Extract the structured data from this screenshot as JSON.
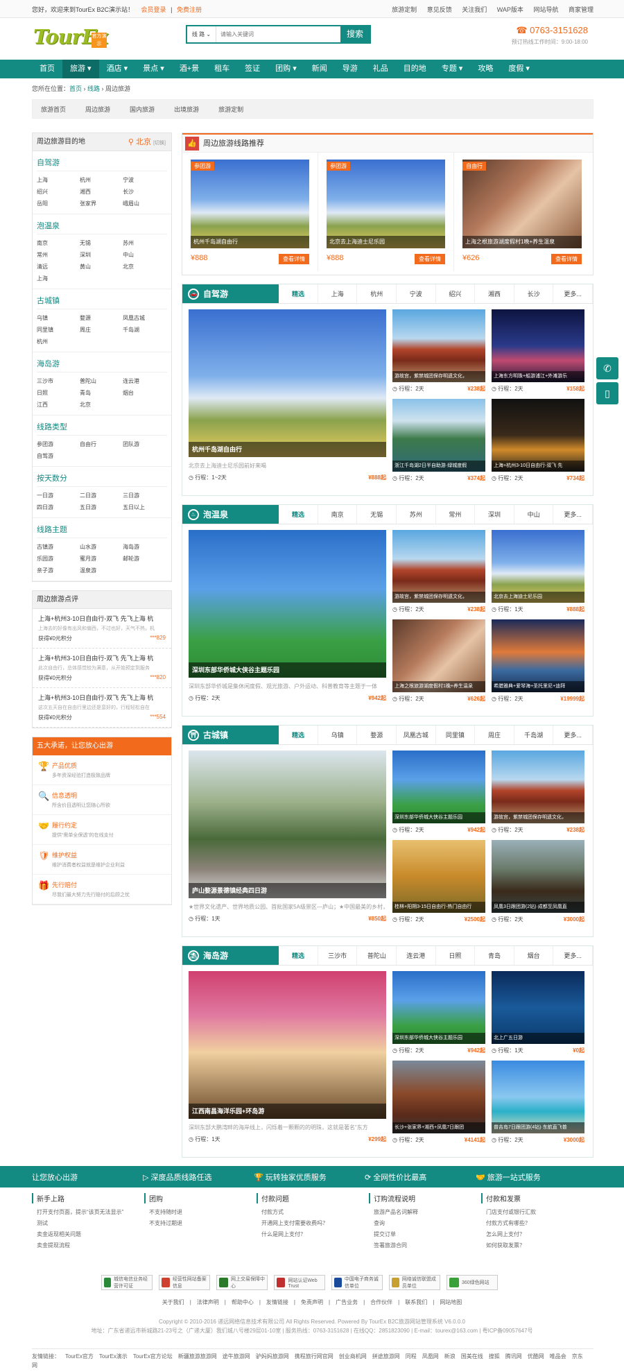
{
  "topbar": {
    "welcome": "您好，欢迎来到TourEx B2C演示站！",
    "login": "会员登录",
    "register": "免费注册",
    "links": [
      "旅游定制",
      "意见反馈",
      "关注我们",
      "WAP版本",
      "网站导航",
      "商家管理"
    ]
  },
  "logo": {
    "text": "TourEx",
    "badge": "官方演示"
  },
  "search": {
    "scope": "线 路",
    "placeholder": "请输入关键词",
    "button": "搜索"
  },
  "hotline": {
    "number": "0763-3151628",
    "hours": "预订热线工作时间：9:00-18:00"
  },
  "nav": [
    "首页",
    "旅游",
    "酒店",
    "景点",
    "酒+景",
    "租车",
    "签证",
    "团购",
    "新闻",
    "导游",
    "礼品",
    "目的地",
    "专题",
    "攻略",
    "度假"
  ],
  "crumb": {
    "prefix": "您所在位置：",
    "home": "首页",
    "line": "线路",
    "current": "周边旅游"
  },
  "subtabs": [
    "旅游首页",
    "周边旅游",
    "国内旅游",
    "出境旅游",
    "旅游定制"
  ],
  "sidebar": {
    "dest_title": "周边旅游目的地",
    "city": "北京",
    "switch": "[切换]",
    "groups": [
      {
        "title": "自驾游",
        "items": [
          "上海",
          "杭州",
          "宁波",
          "绍兴",
          "湘西",
          "长沙",
          "岳阳",
          "张家界",
          "峨眉山"
        ]
      },
      {
        "title": "泡温泉",
        "items": [
          "南京",
          "无锡",
          "苏州",
          "常州",
          "深圳",
          "中山",
          "清远",
          "黄山",
          "北京",
          "上海"
        ]
      },
      {
        "title": "古城镇",
        "items": [
          "乌镇",
          "婺源",
          "凤凰古城",
          "同里镇",
          "周庄",
          "千岛湖",
          "杭州"
        ]
      },
      {
        "title": "海岛游",
        "items": [
          "三沙市",
          "普陀山",
          "连云港",
          "日照",
          "青岛",
          "烟台",
          "江西",
          "北京"
        ]
      },
      {
        "title": "线路类型",
        "items": [
          "参团游",
          "自由行",
          "团队游",
          "自驾游"
        ]
      },
      {
        "title": "按天数分",
        "items": [
          "一日游",
          "二日游",
          "三日游",
          "四日游",
          "五日游",
          "五日以上"
        ]
      },
      {
        "title": "线路主题",
        "items": [
          "古镇游",
          "山水游",
          "海岛游",
          "乐园游",
          "蜜月游",
          "邮轮游",
          "亲子游",
          "温泉游"
        ]
      }
    ],
    "review_title": "周边旅游点评",
    "reviews": [
      {
        "title": "上海+杭州3-10日自由行-双飞 先飞上海 杭",
        "content": "上海去的好像有出风和偏西，不过也好，天气不热，机",
        "points": "获得¥0元积分",
        "user": "***829"
      },
      {
        "title": "上海+杭州3-10日自由行-双飞 先飞上海 杭",
        "content": "此次自由行，总体感觉较为满意，从开始预定到服务",
        "points": "获得¥0元积分",
        "user": "***820"
      },
      {
        "title": "上海+杭州3-10日自由行-双飞 先飞上海 杭",
        "content": "这次五天自在自由行里边还是蛮好的，行程轻松自在",
        "points": "获得¥0元积分",
        "user": "***554"
      }
    ],
    "promise_title": "五大承诺，让您放心出游",
    "promises": [
      {
        "t": "产品优质",
        "d": "多年资深经验打造极致品牌"
      },
      {
        "t": "信息透明",
        "d": "所含价目透明让您随心所欲"
      },
      {
        "t": "履行约定",
        "d": "提供“需单全保透”的在线支付"
      },
      {
        "t": "维护权益",
        "d": "维护消费者权益就是维护企业利益"
      },
      {
        "t": "先行赔付",
        "d": "尽我们最大努力先行赔付的后顾之忧"
      }
    ]
  },
  "recommend": {
    "title": "周边旅游线路推荐",
    "detail": "查看详情",
    "items": [
      {
        "tag": "参团游",
        "name": "杭州千岛湖自由行",
        "price": "¥888"
      },
      {
        "tag": "参团游",
        "name": "北京去上海迪士尼乐园",
        "price": "¥888"
      },
      {
        "tag": "自由行",
        "name": "上海之根旅游湖度假村1晚+养生温泉",
        "price": "¥626"
      }
    ]
  },
  "sections": [
    {
      "title": "自驾游",
      "tabs": [
        "精选",
        "上海",
        "杭州",
        "宁波",
        "绍兴",
        "湘西",
        "长沙",
        "更多..."
      ],
      "big": {
        "name": "杭州千岛湖自由行",
        "desc": "北京去上海迪士尼乐园前好来喝",
        "days": "行程：1~2天",
        "price": "¥888起"
      },
      "small": [
        {
          "name": "游故宫，紫禁城团保存明遗文化，",
          "days": "行程：2天",
          "price": "¥238起"
        },
        {
          "name": "上海东方明珠+船游浦江+外滩游乐",
          "days": "行程：2天",
          "price": "¥158起"
        },
        {
          "name": "浙江千岛湖2日半自助游·绿城度假",
          "days": "行程：2天",
          "price": "¥374起"
        },
        {
          "name": "上海+杭州3-10日自由行-双飞 先",
          "days": "行程：2天",
          "price": "¥734起"
        }
      ]
    },
    {
      "title": "泡温泉",
      "tabs": [
        "精选",
        "南京",
        "无锡",
        "苏州",
        "常州",
        "深圳",
        "中山",
        "更多..."
      ],
      "big": {
        "name": "深圳东部华侨城大侠谷主题乐园",
        "desc": "深圳东部华侨城是集休闲度假、观光旅游、户外运动、科普教育等主题于一体",
        "days": "行程：2天",
        "price": "¥942起"
      },
      "small": [
        {
          "name": "游故宫，紫禁城团保存明遗文化，",
          "days": "行程：2天",
          "price": "¥238起"
        },
        {
          "name": "北京去上海迪士尼乐园",
          "days": "行程：1天",
          "price": "¥888起"
        },
        {
          "name": "上海之根旅游湖度假村1晚+养生温泉",
          "days": "行程：2天",
          "price": "¥626起"
        },
        {
          "name": "希腊雅典+爱琴海+圣托里尼+迪拜",
          "days": "行程：2天",
          "price": "¥19999起"
        }
      ]
    },
    {
      "title": "古城镇",
      "tabs": [
        "精选",
        "乌镇",
        "婺源",
        "凤凰古城",
        "同里镇",
        "周庄",
        "千岛湖",
        "更多..."
      ],
      "big": {
        "name": "庐山婺源景德镇经典四日游",
        "desc": "★世界文化遗产、世界地质公园、首批国家5A级景区—庐山；★中国最美的乡村，朱",
        "days": "行程：1天",
        "price": "¥850起"
      },
      "small": [
        {
          "name": "深圳东部华侨城大侠谷主题乐园",
          "days": "行程：2天",
          "price": "¥942起"
        },
        {
          "name": "游故宫，紫禁城团保存明遗文化，",
          "days": "行程：2天",
          "price": "¥238起"
        },
        {
          "name": "桂林+阳朔3-15日自由行-热门自由行",
          "days": "行程：2天",
          "price": "¥2500起"
        },
        {
          "name": "凤凰3日跟团游(2钻)·成都至凤凰直",
          "days": "行程：2天",
          "price": "¥3000起"
        }
      ]
    },
    {
      "title": "海岛游",
      "tabs": [
        "精选",
        "三沙市",
        "普陀山",
        "连云港",
        "日照",
        "青岛",
        "烟台",
        "更多..."
      ],
      "big": {
        "name": "江西南昌海洋乐园+环岛游",
        "desc": "深圳东部大鹏湾畔的海岸线上，闪烁着一颗颗的的明珠，这就是著名“东方",
        "days": "行程：1天",
        "price": "¥299起"
      },
      "small": [
        {
          "name": "深圳东部华侨城大侠谷主题乐园",
          "days": "行程：2天",
          "price": "¥942起"
        },
        {
          "name": "北上广五日游",
          "days": "行程：1天",
          "price": "¥0起"
        },
        {
          "name": "长沙+张家界+湘西+凤凰7日跟团",
          "days": "行程：2天",
          "price": "¥4141起"
        },
        {
          "name": "普吉岛7日跟团游(4钻)·东航直飞普",
          "days": "行程：2天",
          "price": "¥3000起"
        }
      ]
    }
  ],
  "services": [
    "让您放心出游",
    "深度品质线路任选",
    "玩转独家优质服务",
    "全网性价比最高",
    "旅游一站式服务"
  ],
  "help": [
    {
      "h": "新手上路",
      "l": [
        "打开支付页面，提示“该页无法显示”",
        "测试",
        "卖金返现相关问题",
        "卖金提现流程"
      ]
    },
    {
      "h": "团购",
      "l": [
        "不支持随时退",
        "不支持过期退"
      ]
    },
    {
      "h": "付款问题",
      "l": [
        "付款方式",
        "开通网上支付需要收费吗？",
        "什么是网上支付？"
      ]
    },
    {
      "h": "订购流程说明",
      "l": [
        "旅游产品名词解释",
        "查询",
        "提交订单",
        "签署旅游合同"
      ]
    },
    {
      "h": "付款和发票",
      "l": [
        "门店支付或银行汇款",
        "付款方式有哪些？",
        "怎么网上支付？",
        "如何获取发票？"
      ]
    }
  ],
  "badges": [
    "城信电信业务经营许可证",
    "经营性网站备案信息",
    "网上交易保障中心",
    "网站认证Web Trust",
    "中国电子商务诚信单位",
    "网络诚信联盟成员单位",
    "360绿色网站"
  ],
  "footer_links": [
    "关于我们",
    "法律声明",
    "帮助中心",
    "友情链接",
    "免责声明",
    "广告业务",
    "合作伙伴",
    "联系我们",
    "网站地图"
  ],
  "copyright": "Copyright © 2010-2016 递远网络信息技术有限公司 All Rights Reserved. Powered By TourEx B2C旅游网站管理系统 V6.0.0.0",
  "address": "地址：广东省递远市新城路21-23号之（广递大厦）我们城八号楼29层01-10室 | 服务热线：0763-3151628 | 在线QQ：2851823090 | E-mail：tourex@163.com | 粤ICP备09057647号",
  "friends": {
    "label": "友情链接：",
    "items": [
      "TourEx官方",
      "TourEx演示",
      "TourEx官方论坛",
      "新疆旅游旅游网",
      "途牛旅游网",
      "驴妈妈旅游网",
      "携程旅行网官网",
      "创业商机网",
      "拼途旅游网",
      "同程",
      "凤凰网",
      "新浪",
      "国美在线",
      "搜狐",
      "腾讯网",
      "优酷网",
      "唯品会",
      "京东网"
    ]
  },
  "colors": {
    "primary": "#138a82",
    "accent": "#f26b1d"
  }
}
